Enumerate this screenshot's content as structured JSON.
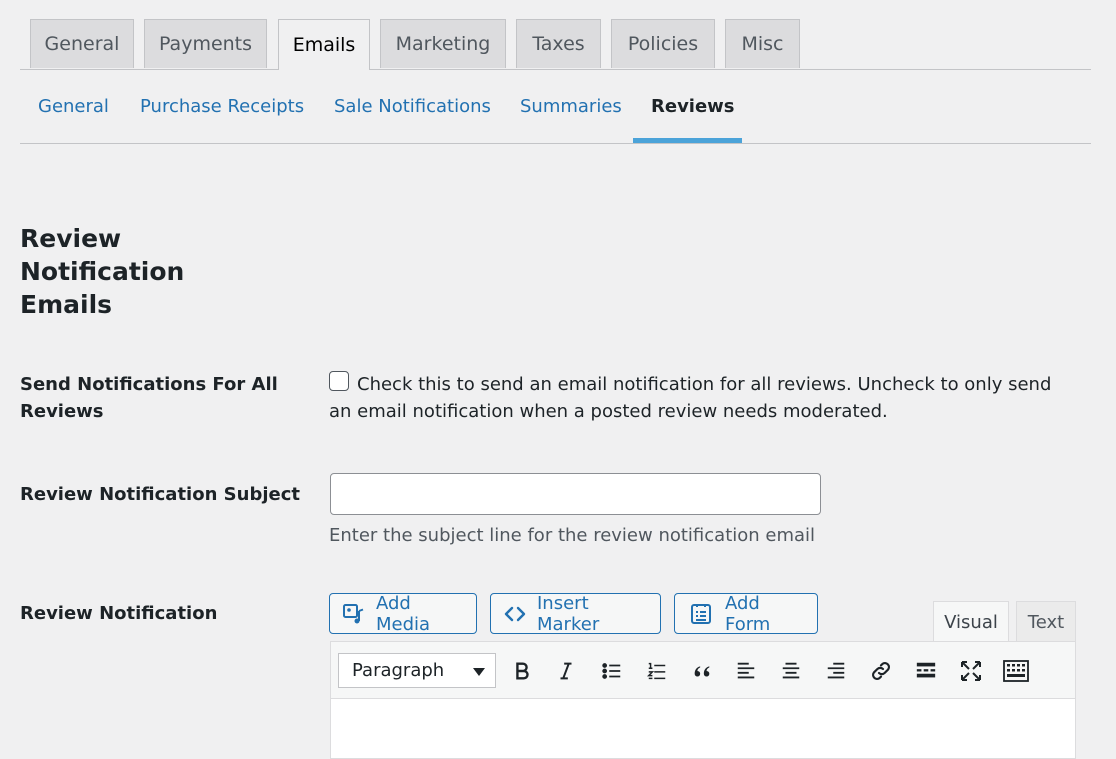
{
  "top_tabs": [
    {
      "label": "General",
      "active": false
    },
    {
      "label": "Payments",
      "active": false
    },
    {
      "label": "Emails",
      "active": true
    },
    {
      "label": "Marketing",
      "active": false
    },
    {
      "label": "Taxes",
      "active": false
    },
    {
      "label": "Policies",
      "active": false
    },
    {
      "label": "Misc",
      "active": false
    }
  ],
  "sub_tabs": [
    {
      "label": "General",
      "active": false
    },
    {
      "label": "Purchase Receipts",
      "active": false
    },
    {
      "label": "Sale Notifications",
      "active": false
    },
    {
      "label": "Summaries",
      "active": false
    },
    {
      "label": "Reviews",
      "active": true
    }
  ],
  "section": {
    "title": "Review Notification Emails"
  },
  "fields": {
    "send_all": {
      "label": "Send Notifications For All Reviews",
      "checked": false,
      "description": "Check this to send an email notification for all reviews. Uncheck to only send an email notification when a posted review needs moderated."
    },
    "subject": {
      "label": "Review Notification Subject",
      "value": "",
      "help": "Enter the subject line for the review notification email"
    },
    "notification": {
      "label": "Review Notification"
    }
  },
  "editor": {
    "buttons": {
      "add_media": "Add Media",
      "insert_marker": "Insert Marker",
      "add_form": "Add Form"
    },
    "tabs": {
      "visual": "Visual",
      "text": "Text"
    },
    "format_select": "Paragraph",
    "toolbar_icons": [
      "bold-icon",
      "italic-icon",
      "bullet-list-icon",
      "numbered-list-icon",
      "blockquote-icon",
      "align-left-icon",
      "align-center-icon",
      "align-right-icon",
      "link-icon",
      "read-more-icon",
      "fullscreen-icon",
      "toolbar-toggle-icon"
    ]
  },
  "colors": {
    "link": "#2271b1",
    "active_underline": "#4ba3d9",
    "background": "#f0f0f1"
  }
}
